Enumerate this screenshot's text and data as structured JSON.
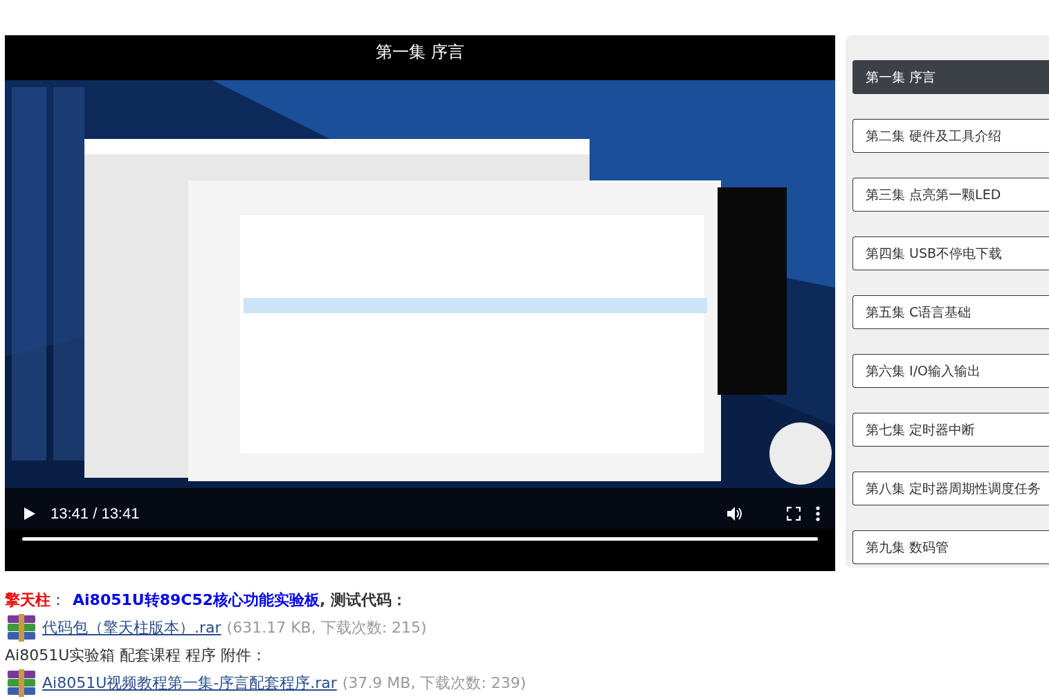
{
  "video": {
    "title": "第一集 序言",
    "time": "13:41 / 13:41",
    "progress": {
      "level": 1
    }
  },
  "episodes": [
    {
      "label": "第一集 序言",
      "selected": true
    },
    {
      "label": "第二集 硬件及工具介绍",
      "selected": false
    },
    {
      "label": "第三集 点亮第一颗LED",
      "selected": false
    },
    {
      "label": "第四集 USB不停电下载",
      "selected": false
    },
    {
      "label": "第五集 C语言基础",
      "selected": false
    },
    {
      "label": "第六集 I/O输入输出",
      "selected": false
    },
    {
      "label": "第七集 定时器中断",
      "selected": false
    },
    {
      "label": "第八集 定时器周期性调度任务",
      "selected": false
    },
    {
      "label": "第九集 数码管",
      "selected": false
    }
  ],
  "content": [
    {
      "kind": "heading",
      "author": "擎天柱",
      "separator": "：",
      "link": "Ai8051U转89C52核心功能实验板",
      "text": ", 测试代码："
    },
    {
      "kind": "attachment",
      "file": "代码包（擎天柱版本）.rar",
      "info": "(631.17 KB, 下载次数: 215)"
    },
    {
      "kind": "text",
      "text": "Ai8051U实验箱 配套课程 程序 附件："
    },
    {
      "kind": "attachment",
      "file": "Ai8051U视频教程第一集-序言配套程序.rar",
      "info": "(37.9 MB, 下载次数: 239)"
    }
  ]
}
